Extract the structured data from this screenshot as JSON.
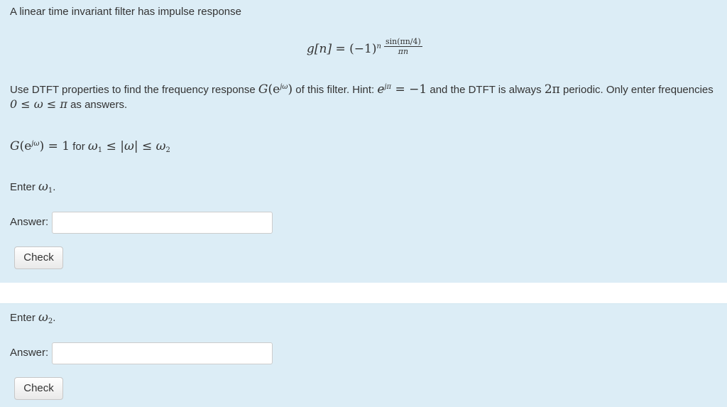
{
  "question": {
    "intro": "A linear time invariant filter has impulse response",
    "formula": {
      "lhs": "g[n]",
      "equals": " = ",
      "base": "(−1)",
      "exponent": "n",
      "frac_num": "sin(πn/4)",
      "frac_den": "πn"
    },
    "body": {
      "part1": "Use DTFT properties to find the frequency response ",
      "G": "G",
      "paren_open": "(e",
      "jw": "jω",
      "paren_close": ")",
      "part2": " of this filter. Hint: ",
      "e": "e",
      "jpi": "jπ",
      "hint_eq": " = −1",
      "part3": " and the DTFT is always ",
      "twopi": "2π",
      "part4": " periodic. Only enter frequencies",
      "range": "0 ≤ ω ≤ π",
      "part5": " as answers."
    },
    "response": {
      "G": "G",
      "paren_open": "(e",
      "jw": "jω",
      "paren_close": ")",
      "eq_one": " = 1",
      "for": " for ",
      "w": "ω",
      "one": "1",
      "le1": " ≤ |ω| ≤ ",
      "w2": "ω",
      "two": "2"
    }
  },
  "parts": [
    {
      "prompt": "Enter ",
      "omega": "ω",
      "sub": "1",
      "dot": ".",
      "answer_label": "Answer:",
      "answer_value": "",
      "check_label": "Check"
    },
    {
      "prompt": "Enter ",
      "omega": "ω",
      "sub": "2",
      "dot": ".",
      "answer_label": "Answer:",
      "answer_value": "",
      "check_label": "Check"
    }
  ],
  "colors": {
    "panel_bg": "#dcedf6",
    "text": "#333333"
  }
}
